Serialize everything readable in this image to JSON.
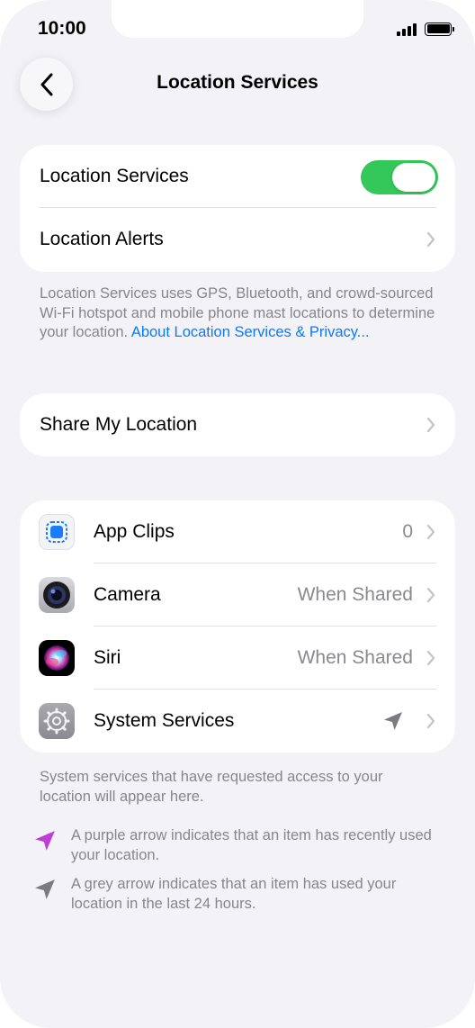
{
  "status_bar": {
    "time": "10:00"
  },
  "header": {
    "title": "Location Services"
  },
  "main_card": {
    "location_services_label": "Location Services",
    "location_services_enabled": true,
    "location_alerts_label": "Location Alerts"
  },
  "description": {
    "text": "Location Services uses GPS, Bluetooth, and crowd-sourced Wi-Fi hotspot and mobile phone mast locations to determine your location. ",
    "link": "About Location Services & Privacy..."
  },
  "share_card": {
    "label": "Share My Location"
  },
  "apps": [
    {
      "name": "App Clips",
      "value": "0",
      "icon": "app-clips-icon"
    },
    {
      "name": "Camera",
      "value": "When Shared",
      "icon": "camera-icon"
    },
    {
      "name": "Siri",
      "value": "When Shared",
      "icon": "siri-icon"
    },
    {
      "name": "System Services",
      "value": "",
      "icon": "location-arrow-grey-icon"
    }
  ],
  "apps_footnote": "System services that have requested access to your location will appear here.",
  "legend": {
    "purple": "A purple arrow indicates that an item has recently used your location.",
    "grey": "A grey arrow indicates that an item has used your location in the last 24 hours."
  },
  "colors": {
    "toggle_on": "#34c759",
    "link": "#0a7aff",
    "purple_arrow": "#bf3ed8",
    "grey_arrow": "#7a7a7f"
  }
}
